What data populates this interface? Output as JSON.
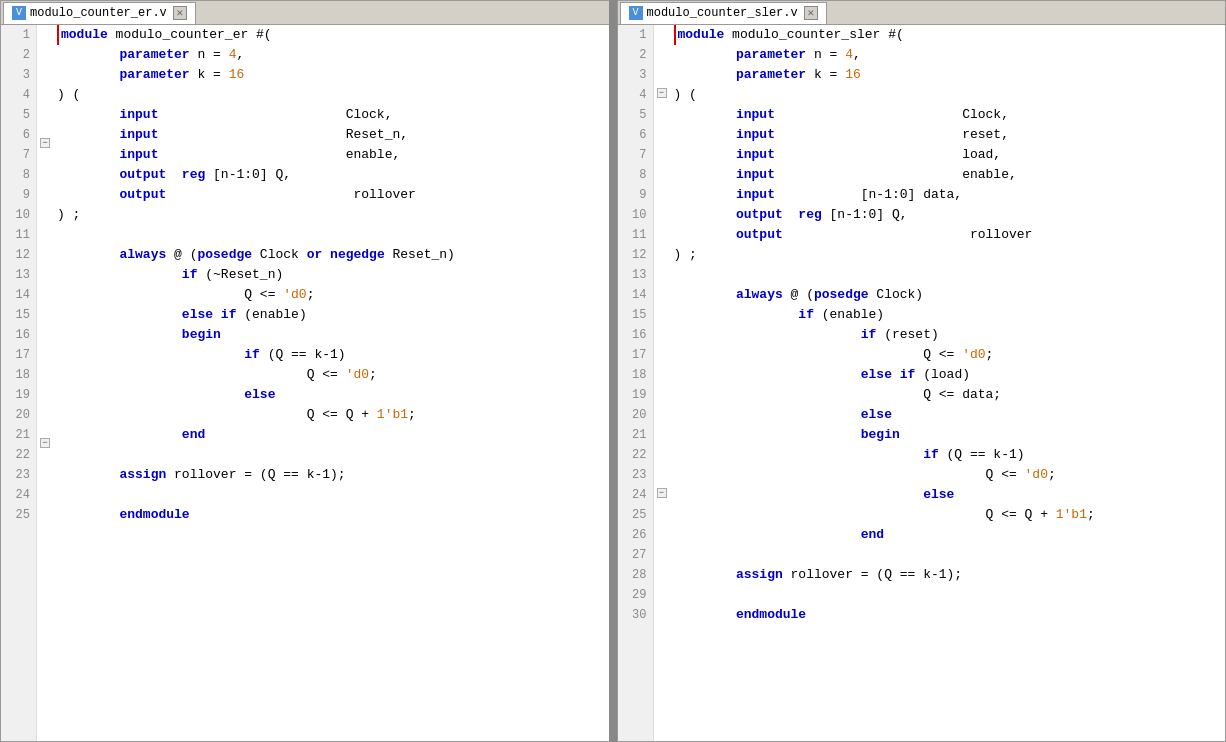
{
  "left_tab": {
    "title": "modulo_counter_er.v",
    "icon": "v"
  },
  "right_tab": {
    "title": "modulo_counter_sler.v",
    "icon": "v"
  },
  "left_lines": [
    {
      "n": 1,
      "code": [
        {
          "t": "module",
          "c": "kw"
        },
        {
          "t": " modulo_counter_er ",
          "c": "plain"
        },
        {
          "t": "#(",
          "c": "plain"
        }
      ],
      "fold": "collapse",
      "module_start": true
    },
    {
      "n": 2,
      "code": [
        {
          "t": "        ",
          "c": "plain"
        },
        {
          "t": "parameter",
          "c": "kw"
        },
        {
          "t": " n = ",
          "c": "plain"
        },
        {
          "t": "4",
          "c": "num"
        },
        {
          "t": ",",
          "c": "plain"
        }
      ]
    },
    {
      "n": 3,
      "code": [
        {
          "t": "        ",
          "c": "plain"
        },
        {
          "t": "parameter",
          "c": "kw"
        },
        {
          "t": " k = ",
          "c": "plain"
        },
        {
          "t": "16",
          "c": "num"
        }
      ]
    },
    {
      "n": 4,
      "code": [
        {
          "t": ") (",
          "c": "plain"
        }
      ]
    },
    {
      "n": 5,
      "code": [
        {
          "t": "        ",
          "c": "plain"
        },
        {
          "t": "input",
          "c": "type"
        },
        {
          "t": "                        Clock,",
          "c": "plain"
        }
      ]
    },
    {
      "n": 6,
      "code": [
        {
          "t": "        ",
          "c": "plain"
        },
        {
          "t": "input",
          "c": "type"
        },
        {
          "t": "                        Reset_n,",
          "c": "plain"
        }
      ]
    },
    {
      "n": 7,
      "code": [
        {
          "t": "        ",
          "c": "plain"
        },
        {
          "t": "input",
          "c": "type"
        },
        {
          "t": "                        enable,",
          "c": "plain"
        }
      ]
    },
    {
      "n": 8,
      "code": [
        {
          "t": "        ",
          "c": "plain"
        },
        {
          "t": "output",
          "c": "type"
        },
        {
          "t": "  ",
          "c": "plain"
        },
        {
          "t": "reg",
          "c": "type"
        },
        {
          "t": " [n-1:0] Q,",
          "c": "plain"
        }
      ]
    },
    {
      "n": 9,
      "code": [
        {
          "t": "        ",
          "c": "plain"
        },
        {
          "t": "output",
          "c": "type"
        },
        {
          "t": "                        rollover",
          "c": "plain"
        }
      ]
    },
    {
      "n": 10,
      "code": [
        {
          "t": ") ;",
          "c": "plain"
        }
      ]
    },
    {
      "n": 11,
      "code": [
        {
          "t": "",
          "c": "plain"
        }
      ]
    },
    {
      "n": 12,
      "code": [
        {
          "t": "        ",
          "c": "plain"
        },
        {
          "t": "always",
          "c": "kw"
        },
        {
          "t": " @ (",
          "c": "plain"
        },
        {
          "t": "posedge",
          "c": "kw"
        },
        {
          "t": " Clock ",
          "c": "plain"
        },
        {
          "t": "or",
          "c": "kw"
        },
        {
          "t": " ",
          "c": "plain"
        },
        {
          "t": "negedge",
          "c": "kw"
        },
        {
          "t": " Reset_n)",
          "c": "plain"
        }
      ]
    },
    {
      "n": 13,
      "code": [
        {
          "t": "                ",
          "c": "plain"
        },
        {
          "t": "if",
          "c": "kw"
        },
        {
          "t": " (~Reset_n)",
          "c": "plain"
        }
      ]
    },
    {
      "n": 14,
      "code": [
        {
          "t": "                        Q <= ",
          "c": "plain"
        },
        {
          "t": "'d0",
          "c": "num"
        },
        {
          "t": ";",
          "c": "plain"
        }
      ]
    },
    {
      "n": 15,
      "code": [
        {
          "t": "                ",
          "c": "plain"
        },
        {
          "t": "else",
          "c": "kw"
        },
        {
          "t": " ",
          "c": "plain"
        },
        {
          "t": "if",
          "c": "kw"
        },
        {
          "t": " (enable)",
          "c": "plain"
        }
      ]
    },
    {
      "n": 16,
      "code": [
        {
          "t": "                ",
          "c": "plain"
        },
        {
          "t": "begin",
          "c": "kw"
        }
      ],
      "fold": "collapse2"
    },
    {
      "n": 17,
      "code": [
        {
          "t": "                        ",
          "c": "plain"
        },
        {
          "t": "if",
          "c": "kw"
        },
        {
          "t": " (Q == k-1)",
          "c": "plain"
        }
      ]
    },
    {
      "n": 18,
      "code": [
        {
          "t": "                                Q <= ",
          "c": "plain"
        },
        {
          "t": "'d0",
          "c": "num"
        },
        {
          "t": ";",
          "c": "plain"
        }
      ]
    },
    {
      "n": 19,
      "code": [
        {
          "t": "                        ",
          "c": "plain"
        },
        {
          "t": "else",
          "c": "kw"
        }
      ]
    },
    {
      "n": 20,
      "code": [
        {
          "t": "                                Q <= Q + ",
          "c": "plain"
        },
        {
          "t": "1'b1",
          "c": "num"
        },
        {
          "t": ";",
          "c": "plain"
        }
      ]
    },
    {
      "n": 21,
      "code": [
        {
          "t": "                ",
          "c": "plain"
        },
        {
          "t": "end",
          "c": "kw"
        }
      ]
    },
    {
      "n": 22,
      "code": [
        {
          "t": "",
          "c": "plain"
        }
      ]
    },
    {
      "n": 23,
      "code": [
        {
          "t": "        ",
          "c": "plain"
        },
        {
          "t": "assign",
          "c": "kw"
        },
        {
          "t": " rollover = (Q == k-1);",
          "c": "plain"
        }
      ]
    },
    {
      "n": 24,
      "code": [
        {
          "t": "",
          "c": "plain"
        }
      ]
    },
    {
      "n": 25,
      "code": [
        {
          "t": "        ",
          "c": "plain"
        },
        {
          "t": "endmodule",
          "c": "kw"
        }
      ]
    }
  ],
  "right_lines": [
    {
      "n": 1,
      "code": [
        {
          "t": "module",
          "c": "kw"
        },
        {
          "t": " modulo_counter_sler ",
          "c": "plain"
        },
        {
          "t": "#(",
          "c": "plain"
        }
      ],
      "fold": "collapse",
      "module_start": true
    },
    {
      "n": 2,
      "code": [
        {
          "t": "        ",
          "c": "plain"
        },
        {
          "t": "parameter",
          "c": "kw"
        },
        {
          "t": " n = ",
          "c": "plain"
        },
        {
          "t": "4",
          "c": "num"
        },
        {
          "t": ",",
          "c": "plain"
        }
      ]
    },
    {
      "n": 3,
      "code": [
        {
          "t": "        ",
          "c": "plain"
        },
        {
          "t": "parameter",
          "c": "kw"
        },
        {
          "t": " k = ",
          "c": "plain"
        },
        {
          "t": "16",
          "c": "num"
        }
      ]
    },
    {
      "n": 4,
      "code": [
        {
          "t": ") (",
          "c": "plain"
        }
      ]
    },
    {
      "n": 5,
      "code": [
        {
          "t": "        ",
          "c": "plain"
        },
        {
          "t": "input",
          "c": "type"
        },
        {
          "t": "                        Clock,",
          "c": "plain"
        }
      ]
    },
    {
      "n": 6,
      "code": [
        {
          "t": "        ",
          "c": "plain"
        },
        {
          "t": "input",
          "c": "type"
        },
        {
          "t": "                        reset,",
          "c": "plain"
        }
      ]
    },
    {
      "n": 7,
      "code": [
        {
          "t": "        ",
          "c": "plain"
        },
        {
          "t": "input",
          "c": "type"
        },
        {
          "t": "                        load,",
          "c": "plain"
        }
      ]
    },
    {
      "n": 8,
      "code": [
        {
          "t": "        ",
          "c": "plain"
        },
        {
          "t": "input",
          "c": "type"
        },
        {
          "t": "                        enable,",
          "c": "plain"
        }
      ]
    },
    {
      "n": 9,
      "code": [
        {
          "t": "        ",
          "c": "plain"
        },
        {
          "t": "input",
          "c": "type"
        },
        {
          "t": "           [n-1:0] data,",
          "c": "plain"
        }
      ]
    },
    {
      "n": 10,
      "code": [
        {
          "t": "        ",
          "c": "plain"
        },
        {
          "t": "output",
          "c": "type"
        },
        {
          "t": "  ",
          "c": "plain"
        },
        {
          "t": "reg",
          "c": "type"
        },
        {
          "t": " [n-1:0] Q,",
          "c": "plain"
        }
      ]
    },
    {
      "n": 11,
      "code": [
        {
          "t": "        ",
          "c": "plain"
        },
        {
          "t": "output",
          "c": "type"
        },
        {
          "t": "                        rollover",
          "c": "plain"
        }
      ]
    },
    {
      "n": 12,
      "code": [
        {
          "t": ") ;",
          "c": "plain"
        }
      ]
    },
    {
      "n": 13,
      "code": [
        {
          "t": "",
          "c": "plain"
        }
      ]
    },
    {
      "n": 14,
      "code": [
        {
          "t": "        ",
          "c": "plain"
        },
        {
          "t": "always",
          "c": "kw"
        },
        {
          "t": " @ (",
          "c": "plain"
        },
        {
          "t": "posedge",
          "c": "kw"
        },
        {
          "t": " Clock)",
          "c": "plain"
        }
      ]
    },
    {
      "n": 15,
      "code": [
        {
          "t": "                ",
          "c": "plain"
        },
        {
          "t": "if",
          "c": "kw"
        },
        {
          "t": " (enable)",
          "c": "plain"
        }
      ]
    },
    {
      "n": 16,
      "code": [
        {
          "t": "                        ",
          "c": "plain"
        },
        {
          "t": "if",
          "c": "kw"
        },
        {
          "t": " (reset)",
          "c": "plain"
        }
      ]
    },
    {
      "n": 17,
      "code": [
        {
          "t": "                                Q <= ",
          "c": "plain"
        },
        {
          "t": "'d0",
          "c": "num"
        },
        {
          "t": ";",
          "c": "plain"
        }
      ]
    },
    {
      "n": 18,
      "code": [
        {
          "t": "                        ",
          "c": "plain"
        },
        {
          "t": "else",
          "c": "kw"
        },
        {
          "t": " ",
          "c": "plain"
        },
        {
          "t": "if",
          "c": "kw"
        },
        {
          "t": " (load)",
          "c": "plain"
        }
      ]
    },
    {
      "n": 19,
      "code": [
        {
          "t": "                                Q <= data;",
          "c": "plain"
        }
      ]
    },
    {
      "n": 20,
      "code": [
        {
          "t": "                        ",
          "c": "plain"
        },
        {
          "t": "else",
          "c": "kw"
        }
      ]
    },
    {
      "n": 21,
      "code": [
        {
          "t": "                        ",
          "c": "plain"
        },
        {
          "t": "begin",
          "c": "kw"
        }
      ],
      "fold": "collapse2"
    },
    {
      "n": 22,
      "code": [
        {
          "t": "                                ",
          "c": "plain"
        },
        {
          "t": "if",
          "c": "kw"
        },
        {
          "t": " (Q == k-1)",
          "c": "plain"
        }
      ]
    },
    {
      "n": 23,
      "code": [
        {
          "t": "                                        Q <= ",
          "c": "plain"
        },
        {
          "t": "'d0",
          "c": "num"
        },
        {
          "t": ";",
          "c": "plain"
        }
      ]
    },
    {
      "n": 24,
      "code": [
        {
          "t": "                                ",
          "c": "plain"
        },
        {
          "t": "else",
          "c": "kw"
        }
      ]
    },
    {
      "n": 25,
      "code": [
        {
          "t": "                                        Q <= Q + ",
          "c": "plain"
        },
        {
          "t": "1'b1",
          "c": "num"
        },
        {
          "t": ";",
          "c": "plain"
        }
      ]
    },
    {
      "n": 26,
      "code": [
        {
          "t": "                        ",
          "c": "plain"
        },
        {
          "t": "end",
          "c": "kw"
        }
      ]
    },
    {
      "n": 27,
      "code": [
        {
          "t": "",
          "c": "plain"
        }
      ]
    },
    {
      "n": 28,
      "code": [
        {
          "t": "        ",
          "c": "plain"
        },
        {
          "t": "assign",
          "c": "kw"
        },
        {
          "t": " rollover = (Q == k-1);",
          "c": "plain"
        }
      ]
    },
    {
      "n": 29,
      "code": [
        {
          "t": "",
          "c": "plain"
        }
      ]
    },
    {
      "n": 30,
      "code": [
        {
          "t": "        ",
          "c": "plain"
        },
        {
          "t": "endmodule",
          "c": "kw"
        }
      ]
    }
  ]
}
